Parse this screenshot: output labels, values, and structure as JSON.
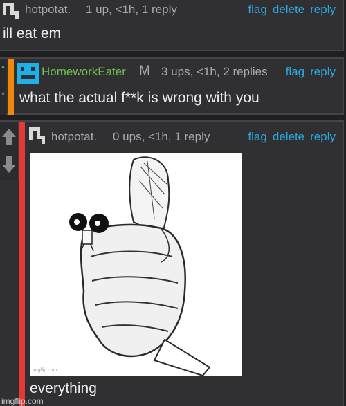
{
  "colors": {
    "background": "#1f1f21",
    "panel": "#303032",
    "link": "#29a9e1",
    "username_green": "#6cc04a",
    "avatar_blue": "#1eb0e6",
    "stripe_orange": "#f0880b",
    "stripe_red": "#e53935"
  },
  "comments": [
    {
      "username": "hotpotat.",
      "meta": "1 up, <1h, 1 reply",
      "actions": [
        "flag",
        "delete",
        "reply"
      ],
      "text": "ill eat em",
      "avatar_icon": "pixel-avatar-icon"
    },
    {
      "username": "HomeworkEater",
      "mod_badge": "M",
      "meta": "3 ups, <1h, 2 replies",
      "actions": [
        "flag",
        "reply"
      ],
      "text": "what the actual f**k is wrong with you",
      "avatar_icon": "blue-face-avatar-icon"
    },
    {
      "username": "hotpotat.",
      "meta": "0 ups, <1h, 1 reply",
      "actions": [
        "flag",
        "delete",
        "reply"
      ],
      "text": "everything",
      "avatar_icon": "pixel-avatar-icon",
      "image_caption": "imgflip.com"
    }
  ],
  "watermark": "imgflip.com"
}
